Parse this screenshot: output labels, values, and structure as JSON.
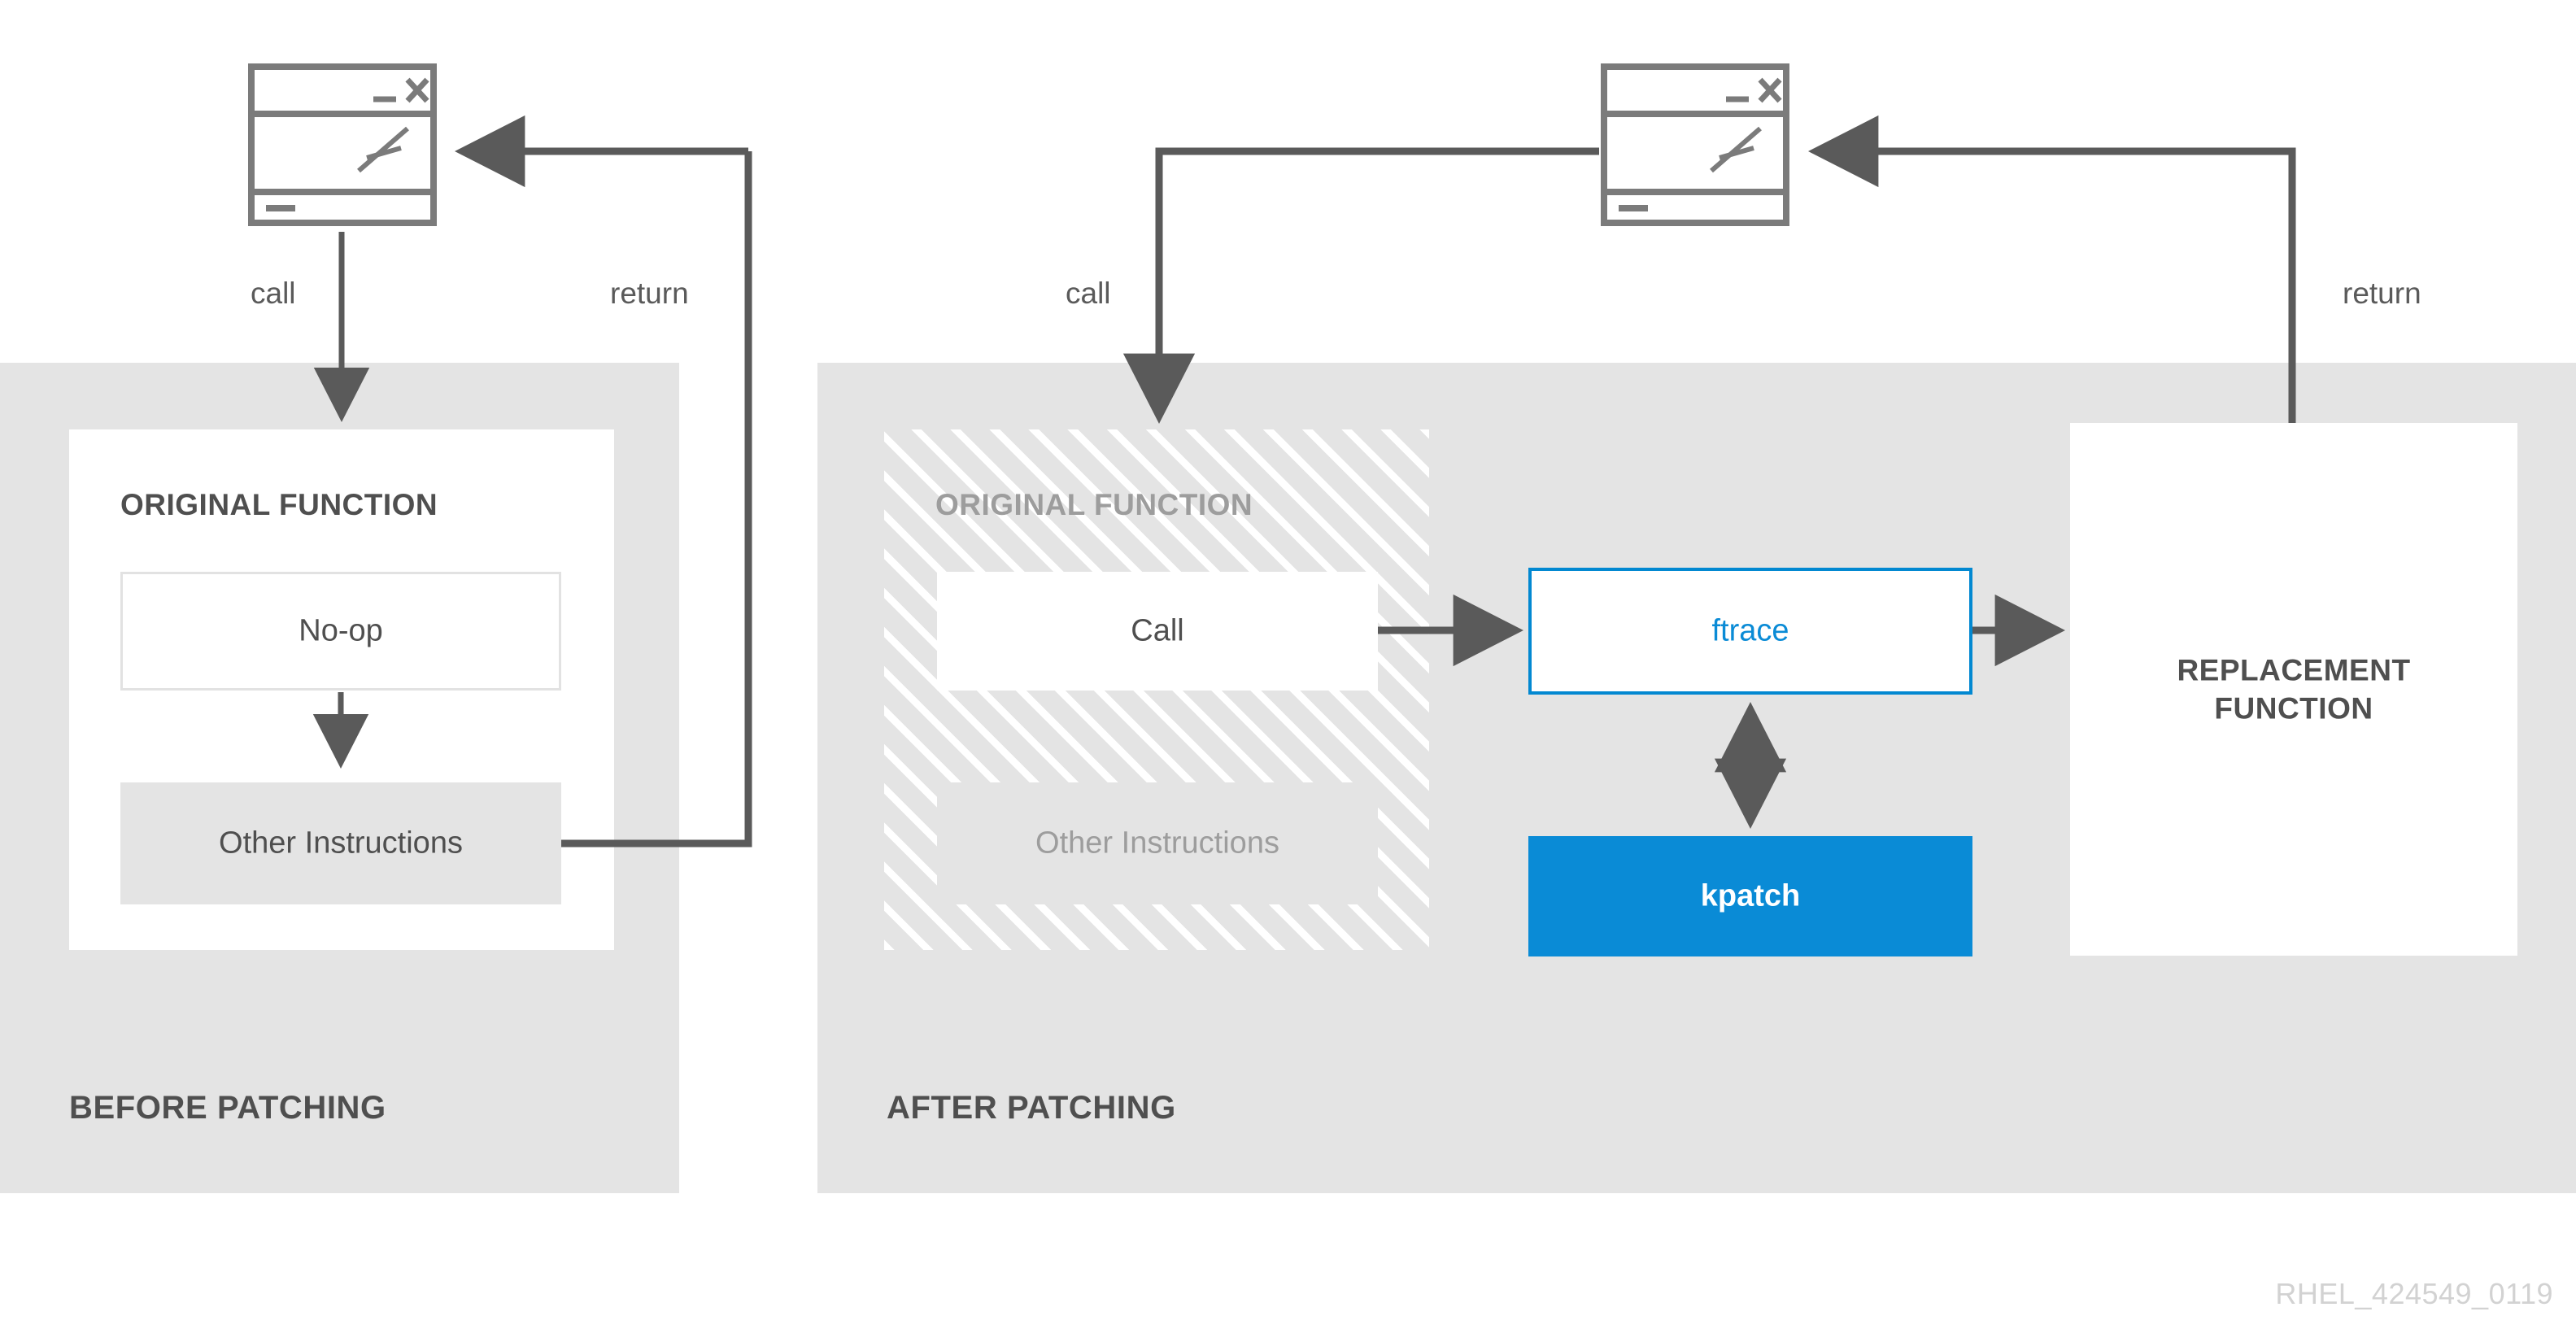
{
  "diagram": {
    "title_watermark": "RHEL_424549_0119",
    "accent_color": "#0a8bd6",
    "panel_color": "#e4e4e4",
    "line_color": "#5a5a5a",
    "text_color": "#4f4f4f",
    "ghost_text_color": "#9d9d9d"
  },
  "before": {
    "caption": "BEFORE PATCHING",
    "function_title": "ORIGINAL FUNCTION",
    "noop_label": "No-op",
    "other_instructions_label": "Other Instructions",
    "call_edge_label": "call",
    "return_edge_label": "return",
    "window_icon": "application-window-icon"
  },
  "after": {
    "caption": "AFTER PATCHING",
    "function_title": "ORIGINAL FUNCTION",
    "call_label": "Call",
    "other_instructions_label": "Other Instructions",
    "ftrace_label": "ftrace",
    "kpatch_label": "kpatch",
    "replacement_label": "REPLACEMENT FUNCTION",
    "replacement_line1": "REPLACEMENT",
    "replacement_line2": "FUNCTION",
    "call_edge_label": "call",
    "return_edge_label": "return",
    "window_icon": "application-window-icon"
  }
}
